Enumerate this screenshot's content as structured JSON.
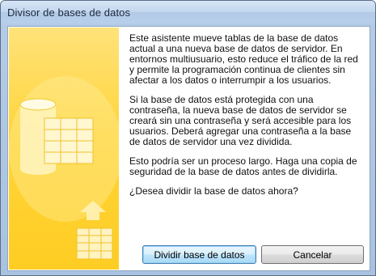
{
  "window": {
    "title": "Divisor de bases de datos"
  },
  "message": {
    "paragraphs": [
      "Este asistente mueve tablas de la base de datos actual a una nueva base de datos de servidor. En entornos multiusuario, esto reduce el tráfico de la red y permite la programación continua de clientes sin afectar a los datos o interrumpir a los usuarios.",
      "Si la base de datos está protegida con una contraseña, la nueva base de datos de servidor se creará sin una contraseña y será accesible para los usuarios. Deberá agregar una contraseña a la base de datos de servidor una vez dividida.",
      "Esto podría ser un proceso largo. Haga una copia de seguridad de la base de datos antes de dividirla.",
      "¿Desea dividir la base de datos ahora?"
    ]
  },
  "buttons": {
    "split_label": "Dividir base de datos",
    "cancel_label": "Cancelar"
  },
  "colors": {
    "art_panel": "#ffd53a",
    "title_bar": "#c1d6ee"
  },
  "icons": {
    "illustration": "database-split-illustration"
  }
}
